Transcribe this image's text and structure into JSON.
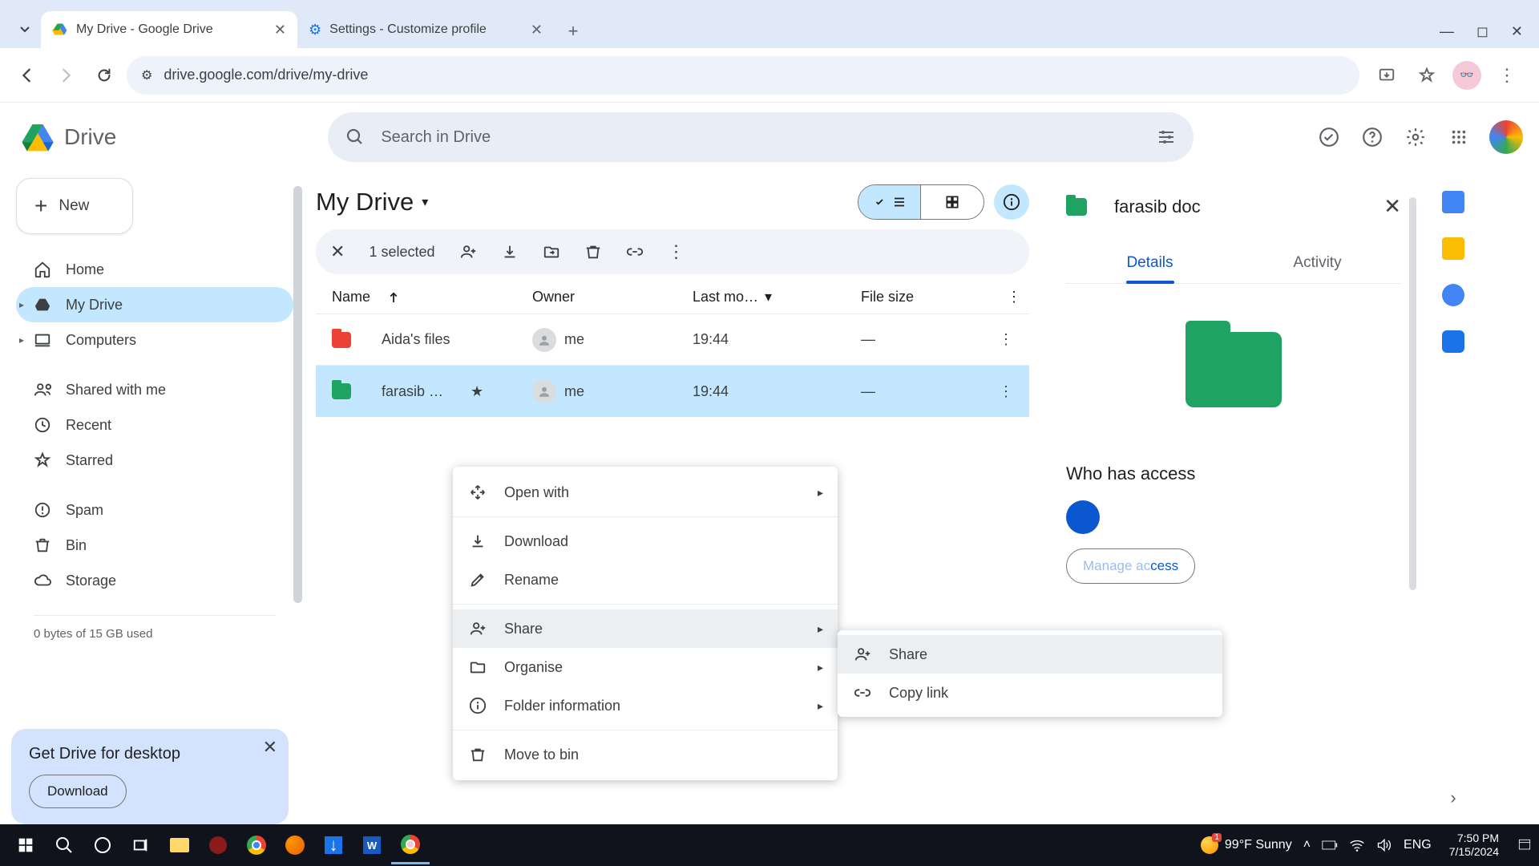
{
  "browser": {
    "tabs": [
      {
        "title": "My Drive - Google Drive",
        "icon": "drive"
      },
      {
        "title": "Settings - Customize profile",
        "icon": "settings"
      }
    ],
    "url": "drive.google.com/drive/my-drive"
  },
  "drive": {
    "brand": "Drive",
    "search_placeholder": "Search in Drive",
    "new_button": "New",
    "nav": {
      "home": "Home",
      "my_drive": "My Drive",
      "computers": "Computers",
      "shared": "Shared with me",
      "recent": "Recent",
      "starred": "Starred",
      "spam": "Spam",
      "bin": "Bin",
      "storage": "Storage"
    },
    "storage_text": "0 bytes of 15 GB used",
    "desktop_promo": {
      "title": "Get Drive for desktop",
      "button": "Download"
    }
  },
  "content": {
    "title": "My Drive",
    "selection_bar": {
      "count": "1 selected"
    },
    "columns": {
      "name": "Name",
      "owner": "Owner",
      "modified": "Last mo…",
      "size": "File size"
    },
    "rows": [
      {
        "name": "Aida's files",
        "owner": "me",
        "modified": "19:44",
        "size": "—",
        "color": "red",
        "starred": false
      },
      {
        "name": "farasib …",
        "owner": "me",
        "modified": "19:44",
        "size": "—",
        "color": "green",
        "starred": true
      }
    ]
  },
  "context_menu": {
    "open_with": "Open with",
    "download": "Download",
    "rename": "Rename",
    "share": "Share",
    "organise": "Organise",
    "folder_info": "Folder information",
    "move_to_bin": "Move to bin",
    "submenu": {
      "share": "Share",
      "copy_link": "Copy link"
    }
  },
  "details": {
    "title": "farasib doc",
    "tabs": {
      "details": "Details",
      "activity": "Activity"
    },
    "access_heading": "Who has access",
    "manage": "Manage access"
  },
  "taskbar": {
    "weather": "99°F  Sunny",
    "lang": "ENG",
    "time": "7:50 PM",
    "date": "7/15/2024"
  }
}
